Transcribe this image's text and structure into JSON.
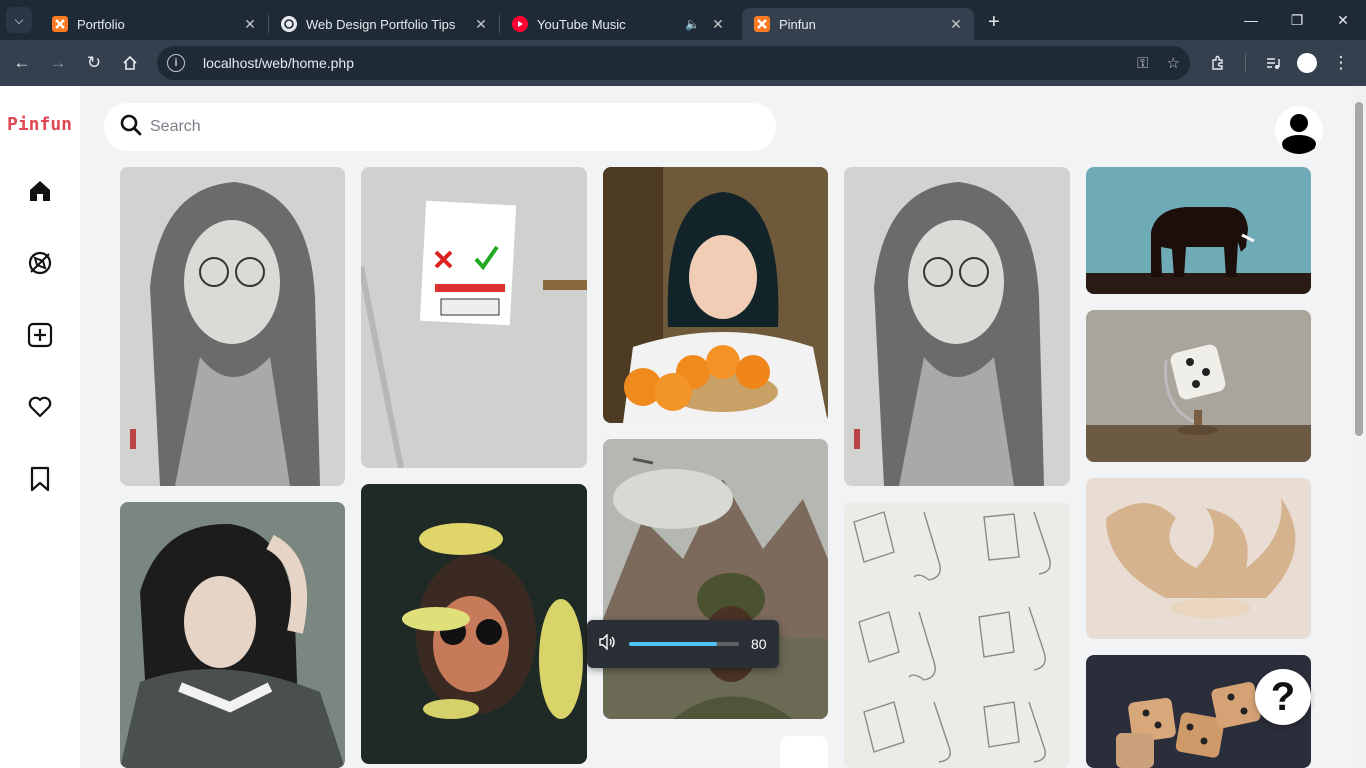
{
  "browser": {
    "tabs": [
      {
        "title": "Portfolio",
        "favicon": "xampp-icon",
        "active": false
      },
      {
        "title": "Web Design Portfolio Tips",
        "favicon": "openai-icon",
        "active": false
      },
      {
        "title": "YouTube Music",
        "favicon": "youtube-music-icon",
        "active": false,
        "audio": true
      },
      {
        "title": "Pinfun",
        "favicon": "xampp-icon",
        "active": true
      }
    ],
    "url": "localhost/web/home.php"
  },
  "app": {
    "logo": "Pinfun",
    "nav": [
      "home-icon",
      "explore-icon",
      "create-icon",
      "favorites-icon",
      "saved-icon"
    ],
    "search": {
      "placeholder": "Search",
      "value": ""
    }
  },
  "pins": [
    {
      "name": "pin-sketch-girl-glasses"
    },
    {
      "name": "pin-door-sign"
    },
    {
      "name": "pin-girl-oranges"
    },
    {
      "name": "pin-sketch-girl-glasses-2"
    },
    {
      "name": "pin-elephant-silhouette"
    },
    {
      "name": "pin-dice-globe"
    },
    {
      "name": "pin-girl-sweater"
    },
    {
      "name": "pin-girl-fish"
    },
    {
      "name": "pin-soldier-painting"
    },
    {
      "name": "pin-nose-sketches"
    },
    {
      "name": "pin-wood-flames"
    },
    {
      "name": "pin-wooden-dice"
    }
  ],
  "volume": {
    "level": 80,
    "label": "80"
  },
  "help_label": "?",
  "colors": {
    "brand": "#e04a55",
    "chrome_dark": "#1f2a37",
    "chrome": "#35404f",
    "page_bg": "#f2f3f5"
  }
}
